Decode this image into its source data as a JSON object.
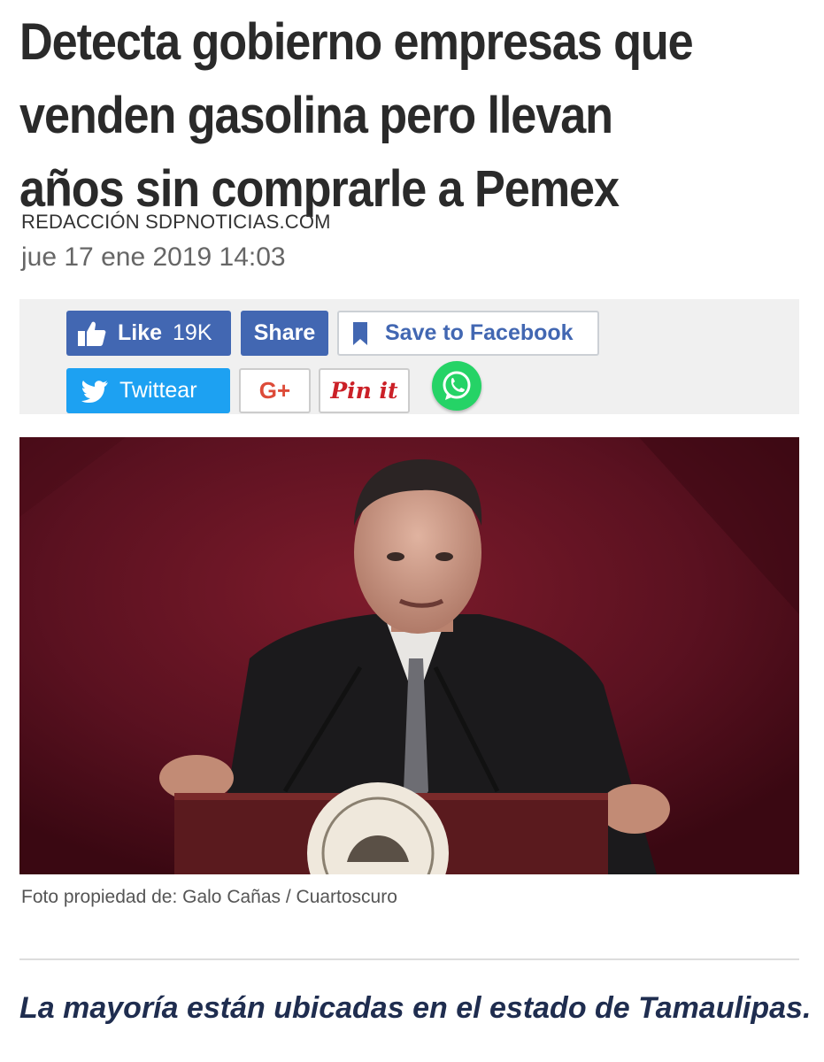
{
  "article": {
    "headline_lines": [
      "Detecta gobierno empresas que",
      "venden gasolina pero llevan",
      "años sin comprarle a Pemex"
    ],
    "author": "REDACCIÓN SDPNOTICIAS.COM",
    "date": "jue 17 ene 2019 14:03",
    "photo_caption": "Foto propiedad de: Galo Cañas / Cuartoscuro",
    "summary": "La mayoría están ubicadas en el estado de Tamaulipas."
  },
  "share": {
    "like_label": "Like",
    "like_count": "19K",
    "share_label": "Share",
    "save_label": "Save to Facebook",
    "twitter_label": "Twittear",
    "gplus_label": "G+",
    "pinit_label": "Pin it",
    "icons": [
      "thumbs-up-icon",
      "bookmark-icon",
      "twitter-bird-icon",
      "whatsapp-icon"
    ]
  },
  "colors": {
    "facebook": "#4267b2",
    "twitter": "#1da1f2",
    "gplus": "#dd4b39",
    "pinterest": "#cb2027",
    "whatsapp": "#25d366",
    "summary_text": "#1f2d4f"
  }
}
